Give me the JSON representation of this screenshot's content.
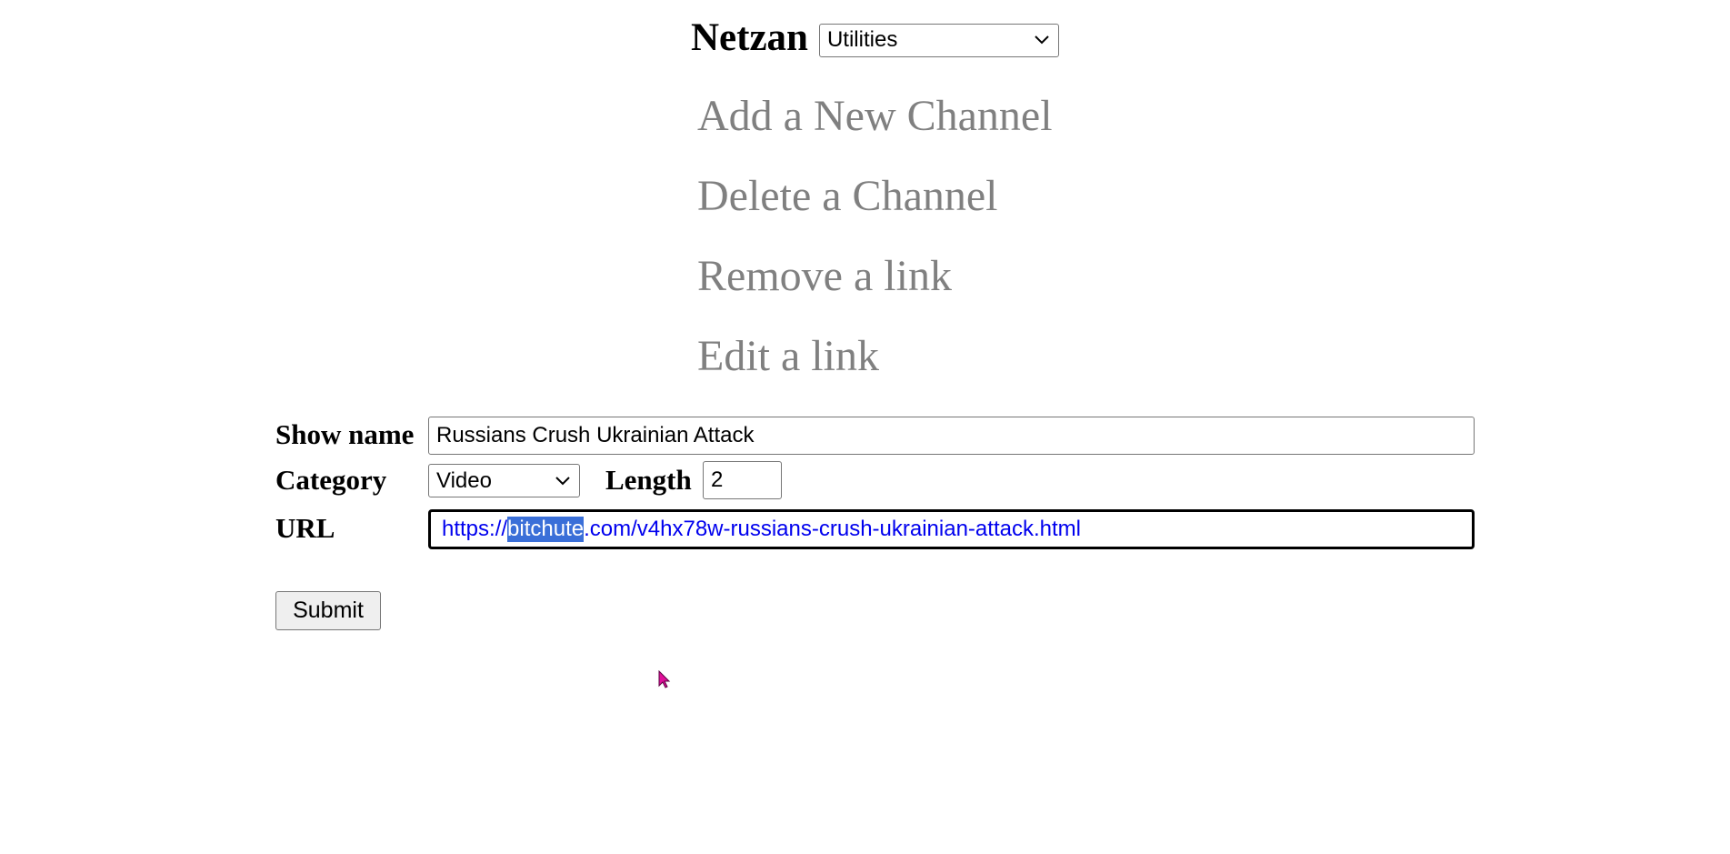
{
  "header": {
    "brand": "Netzan",
    "section_select": {
      "value": "Utilities",
      "icon": "chevron-down-icon"
    }
  },
  "menu": [
    {
      "label": "Add a New Channel"
    },
    {
      "label": "Delete a Channel"
    },
    {
      "label": "Remove a link"
    },
    {
      "label": "Edit a link"
    }
  ],
  "form": {
    "show_name": {
      "label": "Show name",
      "value": "Russians Crush Ukrainian Attack"
    },
    "category": {
      "label": "Category",
      "value": "Video",
      "icon": "chevron-down-icon"
    },
    "length": {
      "label": "Length",
      "value": "2"
    },
    "url": {
      "label": "URL",
      "value_prefix": "https://",
      "value_selected": "bitchute",
      "value_suffix": ".com/v4hx78w-russians-crush-ukrainian-attack.html"
    },
    "submit_label": "Submit"
  },
  "colors": {
    "menu_link": "#808080",
    "url_text": "#0000ee",
    "selection": "#3a6fd8",
    "cursor": "#e0109a"
  }
}
